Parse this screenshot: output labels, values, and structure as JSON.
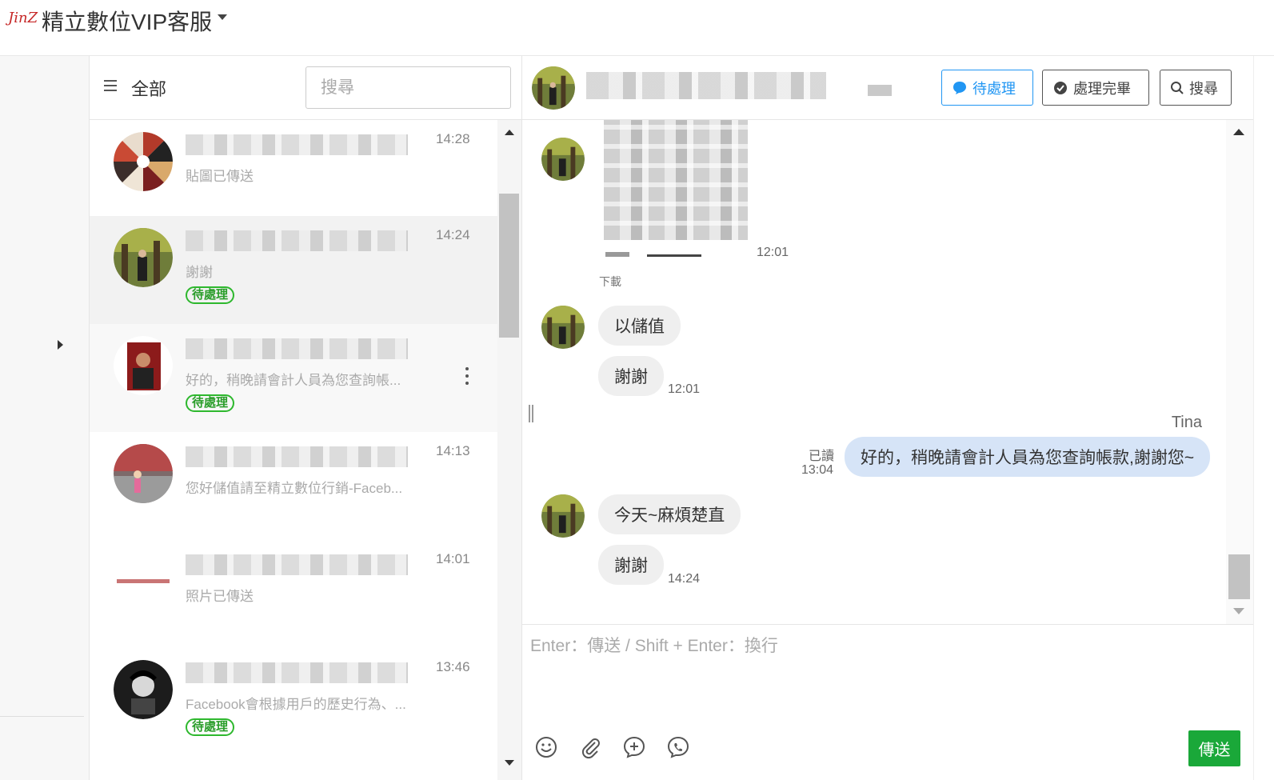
{
  "app": {
    "logo_text": "JinZ",
    "title": "精立數位VIP客服"
  },
  "list": {
    "filter_label": "全部",
    "search_placeholder": "搜尋",
    "conversations": [
      {
        "time": "14:28",
        "preview": "貼圖已傳送",
        "pending": false
      },
      {
        "time": "14:24",
        "preview": "謝謝",
        "pending": true
      },
      {
        "time": "",
        "preview": "好的，稍晚請會計人員為您查詢帳...",
        "pending": true
      },
      {
        "time": "14:13",
        "preview": "您好儲值請至精立數位行銷-Faceb...",
        "pending": false
      },
      {
        "time": "14:01",
        "preview": "照片已傳送",
        "pending": false
      },
      {
        "time": "13:46",
        "preview": "Facebook會根據用戶的歷史行為、...",
        "pending": true
      }
    ],
    "pending_label": "待處理"
  },
  "chat": {
    "buttons": {
      "pending": "待處理",
      "done": "處理完畢",
      "search": "搜尋"
    },
    "messages": {
      "image_time": "12:01",
      "download": "下載",
      "m1": "以儲值",
      "m2": "謝謝",
      "m2_time": "12:01",
      "agent_name": "Tina",
      "read_label": "已讀",
      "read_time": "13:04",
      "m3": "好的，稍晚請會計人員為您查詢帳款,謝謝您~",
      "m4": "今天~麻煩楚直",
      "m5": "謝謝",
      "m5_time": "14:24"
    },
    "composer": {
      "placeholder": "Enter：傳送 / Shift + Enter：換行",
      "send_label": "傳送"
    }
  },
  "colors": {
    "accent_blue": "#2196f3",
    "pending_green": "#2eb82e",
    "send_green": "#1aa839",
    "my_bubble": "#d6e4f7"
  }
}
